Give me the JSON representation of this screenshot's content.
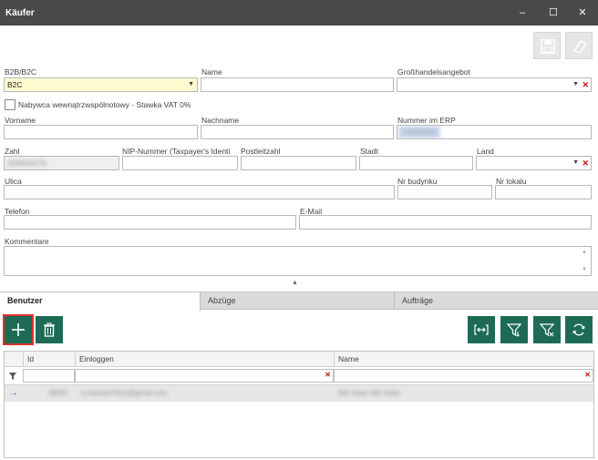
{
  "window": {
    "title": "Käufer",
    "minimize": "–",
    "maximize": "☐",
    "close": "✕"
  },
  "toolbar": {
    "save_icon": "save-icon",
    "clear_icon": "eraser-icon"
  },
  "form": {
    "b2b_label": "B2B/B2C",
    "b2b_value": "B2C",
    "name_label": "Name",
    "name_value": "",
    "wholesale_label": "Großhandelsangebot",
    "wholesale_value": "",
    "intra_community_label": "Nabywca wewnątrzwspólnotowy - Stawka VAT 0%",
    "firstname_label": "Vorname",
    "firstname_value": "",
    "lastname_label": "Nachname",
    "lastname_value": "",
    "erp_label": "Nummer im ERP",
    "erp_value": "10000000",
    "number_label": "Zahl",
    "number_value": "000000079",
    "nip_label": "NIP-Nummer (Taxpayer's Identi",
    "nip_value": "",
    "postcode_label": "Postleitzahl",
    "postcode_value": "",
    "city_label": "Stadt",
    "city_value": "",
    "country_label": "Land",
    "country_value": "",
    "street_label": "Ulica",
    "street_value": "",
    "building_label": "Nr budynku",
    "building_value": "",
    "apartment_label": "Nr lokalu",
    "apartment_value": "",
    "phone_label": "Telefon",
    "phone_value": "",
    "email_label": "E-Mail",
    "email_value": "",
    "comments_label": "Kommentare",
    "comments_value": ""
  },
  "tabs": [
    {
      "label": "Benutzer",
      "active": true
    },
    {
      "label": "Abzüge",
      "active": false
    },
    {
      "label": "Aufträge",
      "active": false
    }
  ],
  "actions": {
    "add_icon": "plus-icon",
    "delete_icon": "trash-icon",
    "fit_icon": "fit-columns-icon",
    "filter_icon": "filter-icon",
    "clear_filter_icon": "clear-filter-icon",
    "refresh_icon": "refresh-icon",
    "accent_color": "#1d6b55"
  },
  "grid": {
    "columns": [
      "Id",
      "Einloggen",
      "Name"
    ],
    "rows": [
      {
        "id": "28097",
        "login": "a.nowicki7811@gmail.com",
        "name": "Nel nowy Nel nowy"
      }
    ]
  }
}
